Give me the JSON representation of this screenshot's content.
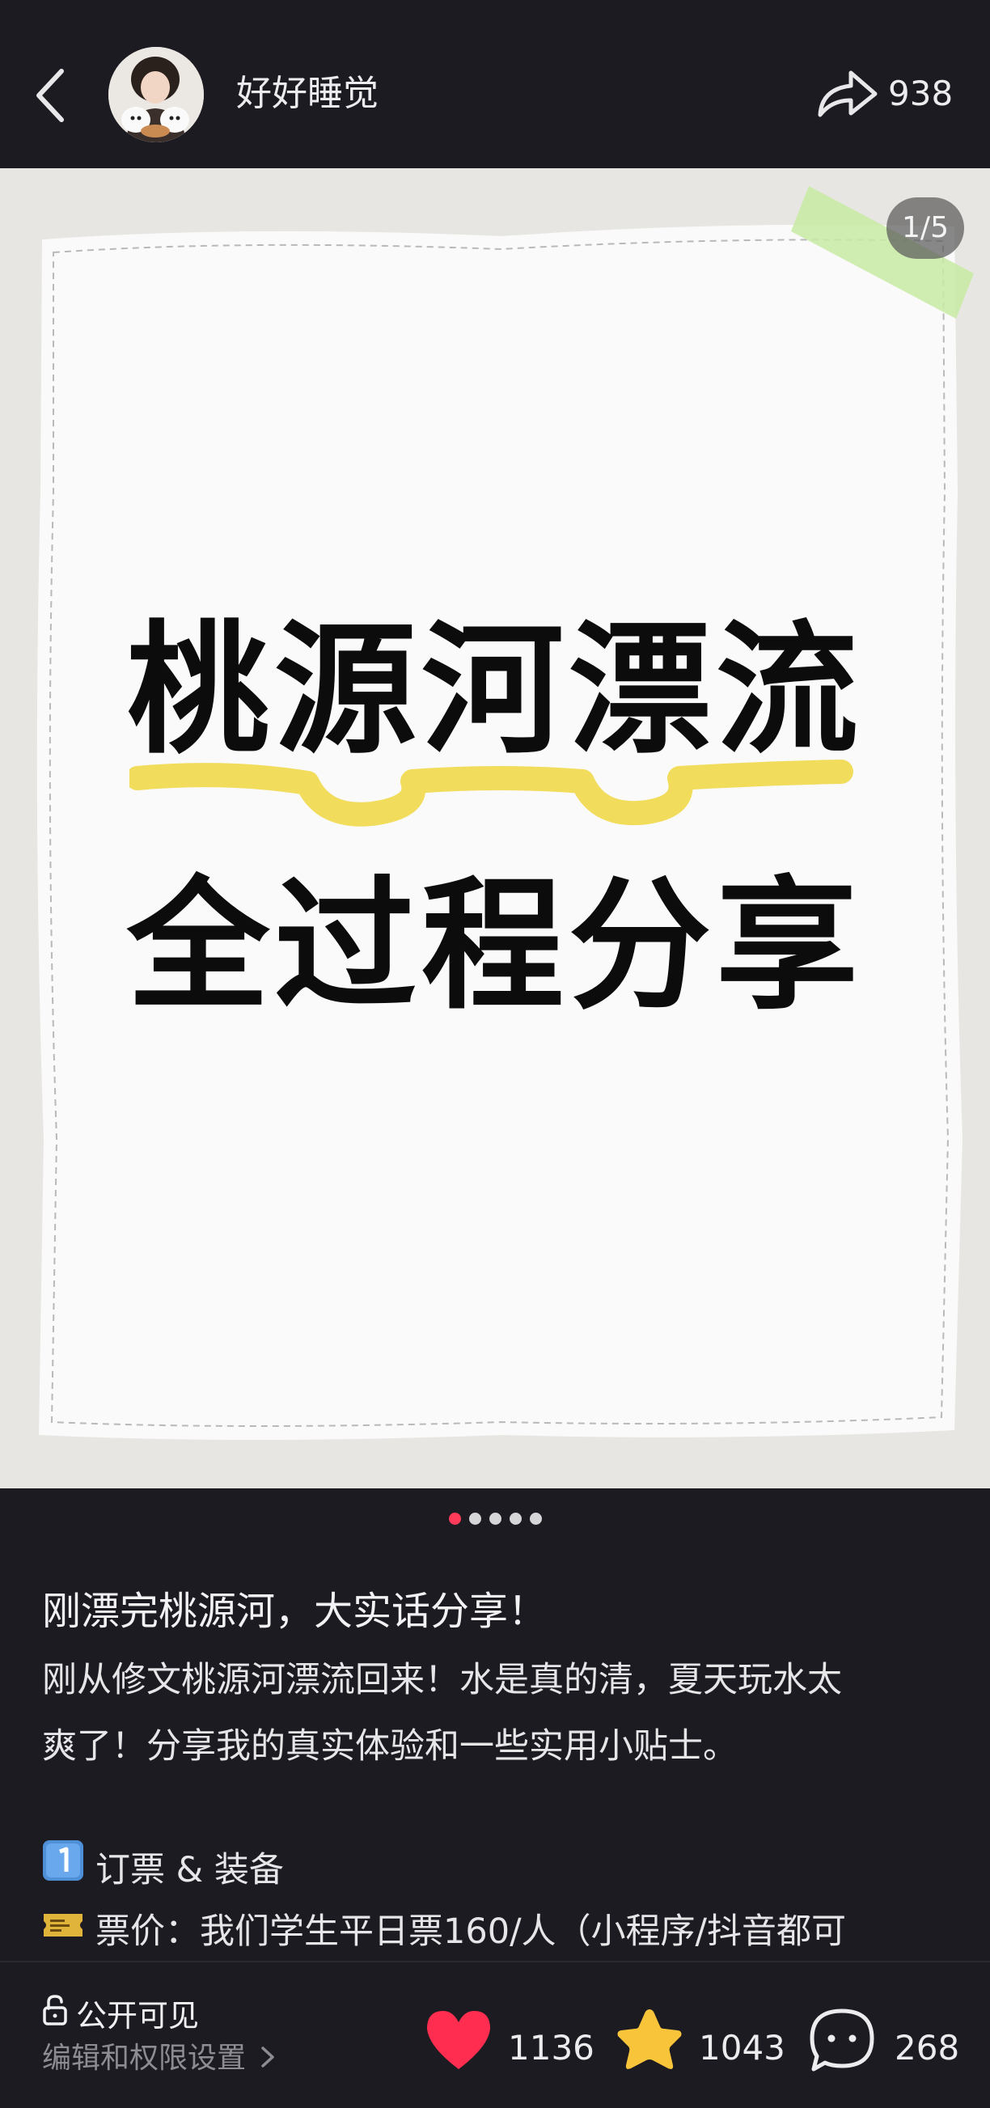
{
  "header": {
    "username": "好好睡觉",
    "share_count": "938",
    "icons": {
      "back": "chevron-left-icon",
      "share": "share-arrow-icon"
    }
  },
  "carousel": {
    "page_indicator": "1/5",
    "cover_line1": "桃源河漂流",
    "cover_line2": "全过程分享",
    "total_pages": 5,
    "active_page": 1,
    "colors": {
      "paper": "#fafafa",
      "tape": "#c8eaa3",
      "highlight": "#f0d84a",
      "background": "#e8e6e2"
    }
  },
  "post": {
    "title": "刚漂完桃源河，大实话分享！",
    "body_line1": "刚从修文桃源河漂流回来！水是真的清，夏天玩水太",
    "body_line2": "爽了！分享我的真实体验和一些实用小贴士。",
    "section1": "订票 & 装备",
    "section1_icon": "keycap-1-icon",
    "section2": "票价：我们学生平日票160/人（小程序/抖音都可",
    "section2_icon": "ticket-icon"
  },
  "footer": {
    "visibility": "公开可见",
    "edit_permissions": "编辑和权限设置",
    "likes": "1136",
    "favorites": "1043",
    "comments": "268",
    "colors": {
      "like": "#ff2d4f",
      "favorite": "#f8c43a"
    }
  }
}
